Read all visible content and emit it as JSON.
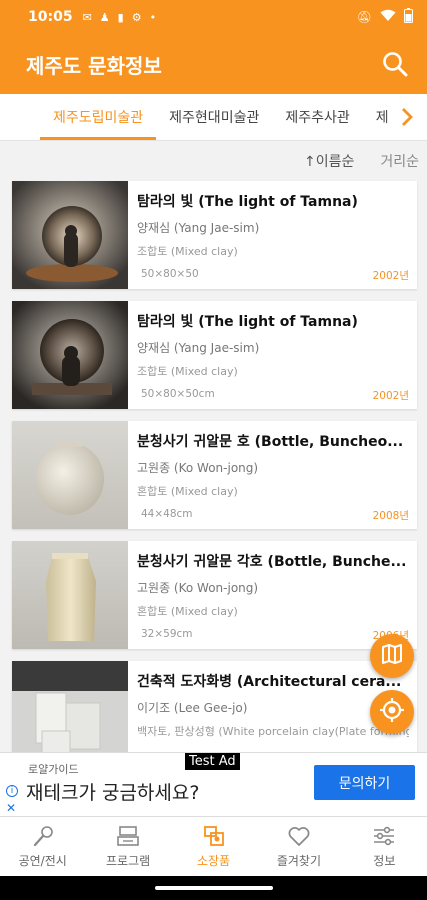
{
  "status": {
    "time": "10:05",
    "icons": [
      "mail-icon",
      "person-icon",
      "battery-saver-icon",
      "settings-icon",
      "dot-icon"
    ],
    "right_icons": [
      "mute-icon",
      "wifi-icon",
      "battery-icon"
    ]
  },
  "app": {
    "title": "제주도 문화정보",
    "accent": "#f7931e"
  },
  "tabs": [
    "제주도립미술관",
    "제주현대미술관",
    "제주추사관",
    "제"
  ],
  "sort": {
    "by_name": "↑이름순",
    "by_distance": "거리순"
  },
  "items": [
    {
      "title": "탐라의 빛 (The light of Tamna)",
      "artist": "양재심 (Yang Jae-sim)",
      "material": "조합토 (Mixed clay)",
      "size": "50×80×50",
      "year": "2002년"
    },
    {
      "title": "탐라의 빛 (The light of Tamna)",
      "artist": "양재심 (Yang Jae-sim)",
      "material": "조합토 (Mixed clay)",
      "size": "50×80×50cm",
      "year": "2002년"
    },
    {
      "title": "분청사기 귀알문 호 (Bottle, Buncheo...",
      "artist": "고원종 (Ko Won-jong)",
      "material": "혼합토 (Mixed clay)",
      "size": "44×48cm",
      "year": "2008년"
    },
    {
      "title": "분청사기 귀알문 각호 (Bottle, Bunche...",
      "artist": "고원종 (Ko Won-jong)",
      "material": "혼합토 (Mixed clay)",
      "size": "32×59cm",
      "year": "2006년"
    },
    {
      "title": "건축적 도자화병 (Architectural cera...",
      "artist": "이기조 (Lee Gee-jo)",
      "material": "백자토, 판상성형 (White porcelain clay(Plate forming))",
      "size": "",
      "year": ""
    }
  ],
  "ad": {
    "label": "Test Ad",
    "brand": "로얄가이드",
    "text": "재테크가 궁금하세요?",
    "cta": "문의하기",
    "info": "i",
    "close": "✕"
  },
  "nav": [
    {
      "label": "공연/전시",
      "icon": "microphone-icon"
    },
    {
      "label": "프로그램",
      "icon": "program-icon"
    },
    {
      "label": "소장품",
      "icon": "collection-icon",
      "active": true
    },
    {
      "label": "즐겨찾기",
      "icon": "heart-icon"
    },
    {
      "label": "정보",
      "icon": "sliders-icon"
    }
  ]
}
